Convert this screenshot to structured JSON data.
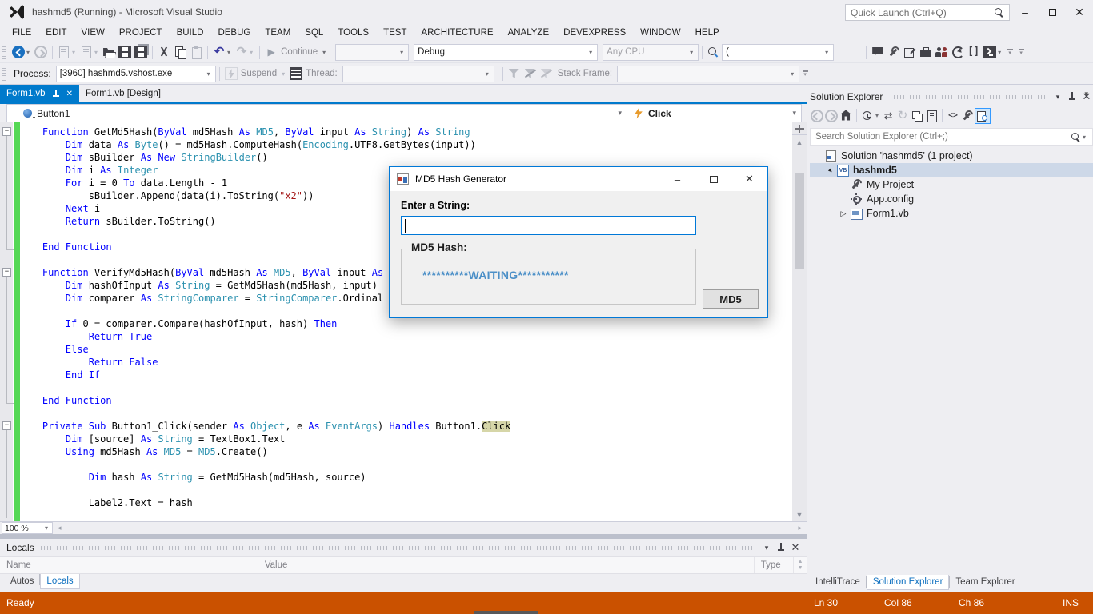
{
  "titlebar": {
    "title": "hashmd5 (Running) - Microsoft Visual Studio",
    "quick_launch_placeholder": "Quick Launch (Ctrl+Q)"
  },
  "menubar": [
    "FILE",
    "EDIT",
    "VIEW",
    "PROJECT",
    "BUILD",
    "DEBUG",
    "TEAM",
    "SQL",
    "TOOLS",
    "TEST",
    "ARCHITECTURE",
    "ANALYZE",
    "DEVEXPRESS",
    "WINDOW",
    "HELP"
  ],
  "toolbar": {
    "continue_label": "Continue",
    "solution_config_value": "Debug",
    "platform_value": "Any CPU",
    "find_value": "("
  },
  "debug_location_toolbar": {
    "process_label": "Process:",
    "process_value": "[3960] hashmd5.vshost.exe",
    "suspend_label": "Suspend",
    "thread_label": "Thread:",
    "thread_value": "",
    "stack_frame_label": "Stack Frame:",
    "stack_frame_value": ""
  },
  "document_tabs": [
    {
      "label": "Form1.vb",
      "active": true
    },
    {
      "label": "Form1.vb [Design]",
      "active": false
    }
  ],
  "navigation_bar": {
    "scope": "Button1",
    "member": "Click"
  },
  "editor": {
    "zoom_value": "100 %",
    "fold_regions": [
      {
        "start": 0,
        "end": 9
      },
      {
        "start": 11,
        "end": 21
      },
      {
        "start": 23,
        "end": -1
      }
    ],
    "lines": [
      {
        "f": "s",
        "t": [
          [
            "k",
            "    Function"
          ],
          [
            "p",
            " GetMd5Hash("
          ],
          [
            "k",
            "ByVal"
          ],
          [
            "p",
            " md5Hash "
          ],
          [
            "k",
            "As"
          ],
          [
            "p",
            " "
          ],
          [
            "t",
            "MD5"
          ],
          [
            "p",
            ", "
          ],
          [
            "k",
            "ByVal"
          ],
          [
            "p",
            " input "
          ],
          [
            "k",
            "As"
          ],
          [
            "p",
            " "
          ],
          [
            "t",
            "String"
          ],
          [
            "p",
            ") "
          ],
          [
            "k",
            "As"
          ],
          [
            "p",
            " "
          ],
          [
            "t",
            "String"
          ]
        ]
      },
      {
        "f": "m",
        "t": [
          [
            "p",
            "        "
          ],
          [
            "k",
            "Dim"
          ],
          [
            "p",
            " data "
          ],
          [
            "k",
            "As"
          ],
          [
            "p",
            " "
          ],
          [
            "t",
            "Byte"
          ],
          [
            "p",
            "() = md5Hash.ComputeHash("
          ],
          [
            "t",
            "Encoding"
          ],
          [
            "p",
            ".UTF8.GetBytes(input))"
          ]
        ]
      },
      {
        "f": "m",
        "t": [
          [
            "p",
            "        "
          ],
          [
            "k",
            "Dim"
          ],
          [
            "p",
            " sBuilder "
          ],
          [
            "k",
            "As"
          ],
          [
            "p",
            " "
          ],
          [
            "k",
            "New"
          ],
          [
            "p",
            " "
          ],
          [
            "t",
            "StringBuilder"
          ],
          [
            "p",
            "()"
          ]
        ]
      },
      {
        "f": "m",
        "t": [
          [
            "p",
            "        "
          ],
          [
            "k",
            "Dim"
          ],
          [
            "p",
            " i "
          ],
          [
            "k",
            "As"
          ],
          [
            "p",
            " "
          ],
          [
            "t",
            "Integer"
          ]
        ]
      },
      {
        "f": "m",
        "t": [
          [
            "p",
            "        "
          ],
          [
            "k",
            "For"
          ],
          [
            "p",
            " i = 0 "
          ],
          [
            "k",
            "To"
          ],
          [
            "p",
            " data.Length - 1"
          ]
        ]
      },
      {
        "f": "m",
        "t": [
          [
            "p",
            "            sBuilder.Append(data(i).ToString("
          ],
          [
            "s",
            "\"x2\""
          ],
          [
            "p",
            "))"
          ]
        ]
      },
      {
        "f": "m",
        "t": [
          [
            "p",
            "        "
          ],
          [
            "k",
            "Next"
          ],
          [
            "p",
            " i"
          ]
        ]
      },
      {
        "f": "m",
        "t": [
          [
            "p",
            "        "
          ],
          [
            "k",
            "Return"
          ],
          [
            "p",
            " sBuilder.ToString()"
          ]
        ]
      },
      {
        "f": "m",
        "t": []
      },
      {
        "f": "e",
        "t": [
          [
            "k",
            "    End Function"
          ]
        ]
      },
      {
        "f": "n",
        "t": []
      },
      {
        "f": "s",
        "t": [
          [
            "k",
            "    Function"
          ],
          [
            "p",
            " VerifyMd5Hash("
          ],
          [
            "k",
            "ByVal"
          ],
          [
            "p",
            " md5Hash "
          ],
          [
            "k",
            "As"
          ],
          [
            "p",
            " "
          ],
          [
            "t",
            "MD5"
          ],
          [
            "p",
            ", "
          ],
          [
            "k",
            "ByVal"
          ],
          [
            "p",
            " input "
          ],
          [
            "k",
            "As"
          ]
        ]
      },
      {
        "f": "m",
        "t": [
          [
            "p",
            "        "
          ],
          [
            "k",
            "Dim"
          ],
          [
            "p",
            " hashOfInput "
          ],
          [
            "k",
            "As"
          ],
          [
            "p",
            " "
          ],
          [
            "t",
            "String"
          ],
          [
            "p",
            " = GetMd5Hash(md5Hash, input)"
          ]
        ]
      },
      {
        "f": "m",
        "t": [
          [
            "p",
            "        "
          ],
          [
            "k",
            "Dim"
          ],
          [
            "p",
            " comparer "
          ],
          [
            "k",
            "As"
          ],
          [
            "p",
            " "
          ],
          [
            "t",
            "StringComparer"
          ],
          [
            "p",
            " = "
          ],
          [
            "t",
            "StringComparer"
          ],
          [
            "p",
            ".Ordinal"
          ]
        ]
      },
      {
        "f": "m",
        "t": []
      },
      {
        "f": "m",
        "t": [
          [
            "p",
            "        "
          ],
          [
            "k",
            "If"
          ],
          [
            "p",
            " 0 = comparer.Compare(hashOfInput, hash) "
          ],
          [
            "k",
            "Then"
          ]
        ]
      },
      {
        "f": "m",
        "t": [
          [
            "p",
            "            "
          ],
          [
            "k",
            "Return"
          ],
          [
            "p",
            " "
          ],
          [
            "k",
            "True"
          ]
        ]
      },
      {
        "f": "m",
        "t": [
          [
            "p",
            "        "
          ],
          [
            "k",
            "Else"
          ]
        ]
      },
      {
        "f": "m",
        "t": [
          [
            "p",
            "            "
          ],
          [
            "k",
            "Return"
          ],
          [
            "p",
            " "
          ],
          [
            "k",
            "False"
          ]
        ]
      },
      {
        "f": "m",
        "t": [
          [
            "p",
            "        "
          ],
          [
            "k",
            "End If"
          ]
        ]
      },
      {
        "f": "m",
        "t": []
      },
      {
        "f": "e",
        "t": [
          [
            "k",
            "    End Function"
          ]
        ]
      },
      {
        "f": "n",
        "t": []
      },
      {
        "f": "s",
        "t": [
          [
            "k",
            "    Private"
          ],
          [
            "p",
            " "
          ],
          [
            "k",
            "Sub"
          ],
          [
            "p",
            " Button1_Click(sender "
          ],
          [
            "k",
            "As"
          ],
          [
            "p",
            " "
          ],
          [
            "t",
            "Object"
          ],
          [
            "p",
            ", e "
          ],
          [
            "k",
            "As"
          ],
          [
            "p",
            " "
          ],
          [
            "t",
            "EventArgs"
          ],
          [
            "p",
            ") "
          ],
          [
            "k",
            "Handles"
          ],
          [
            "p",
            " Button1."
          ],
          [
            "h",
            "Click"
          ]
        ]
      },
      {
        "f": "m",
        "t": [
          [
            "p",
            "        "
          ],
          [
            "k",
            "Dim"
          ],
          [
            "p",
            " [source] "
          ],
          [
            "k",
            "As"
          ],
          [
            "p",
            " "
          ],
          [
            "t",
            "String"
          ],
          [
            "p",
            " = TextBox1.Text"
          ]
        ]
      },
      {
        "f": "m",
        "t": [
          [
            "p",
            "        "
          ],
          [
            "k",
            "Using"
          ],
          [
            "p",
            " md5Hash "
          ],
          [
            "k",
            "As"
          ],
          [
            "p",
            " "
          ],
          [
            "t",
            "MD5"
          ],
          [
            "p",
            " = "
          ],
          [
            "t",
            "MD5"
          ],
          [
            "p",
            ".Create()"
          ]
        ]
      },
      {
        "f": "m",
        "t": []
      },
      {
        "f": "m",
        "t": [
          [
            "p",
            "            "
          ],
          [
            "k",
            "Dim"
          ],
          [
            "p",
            " hash "
          ],
          [
            "k",
            "As"
          ],
          [
            "p",
            " "
          ],
          [
            "t",
            "String"
          ],
          [
            "p",
            " = GetMd5Hash(md5Hash, source)"
          ]
        ]
      },
      {
        "f": "m",
        "t": []
      },
      {
        "f": "m",
        "t": [
          [
            "p",
            "            Label2.Text = hash"
          ]
        ]
      }
    ]
  },
  "dialog": {
    "title": "MD5 Hash Generator",
    "prompt_label": "Enter a String:",
    "input_value": "",
    "group_label": "MD5 Hash:",
    "hash_placeholder": "**********WAITING***********",
    "button_label": "MD5"
  },
  "solution_explorer": {
    "title": "Solution Explorer",
    "search_placeholder": "Search Solution Explorer (Ctrl+;)",
    "tree": [
      {
        "depth": 0,
        "icon": "solution",
        "label": "Solution 'hashmd5' (1 project)",
        "arrow": "none",
        "selected": false,
        "bold": false
      },
      {
        "depth": 1,
        "icon": "vb-project",
        "label": "hashmd5",
        "arrow": "expanded",
        "selected": true,
        "bold": true
      },
      {
        "depth": 2,
        "icon": "my-project",
        "label": "My Project",
        "arrow": "none",
        "selected": false,
        "bold": false
      },
      {
        "depth": 2,
        "icon": "app-config",
        "label": "App.config",
        "arrow": "none",
        "selected": false,
        "bold": false
      },
      {
        "depth": 2,
        "icon": "form",
        "label": "Form1.vb",
        "arrow": "collapsed",
        "selected": false,
        "bold": false
      }
    ]
  },
  "locals_panel": {
    "title": "Locals",
    "columns": [
      "Name",
      "Value",
      "Type"
    ],
    "tabs": [
      {
        "label": "Autos",
        "active": false
      },
      {
        "label": "Locals",
        "active": true
      }
    ]
  },
  "panel_tabs": [
    {
      "label": "IntelliTrace",
      "active": false
    },
    {
      "label": "Solution Explorer",
      "active": true
    },
    {
      "label": "Team Explorer",
      "active": false
    }
  ],
  "statusbar": {
    "status": "Ready",
    "line": "Ln 30",
    "column": "Col 86",
    "character": "Ch 86",
    "mode": "INS"
  },
  "colors": {
    "accent": "#007acc",
    "status_debug": "#ca5100",
    "keyword": "#0000ff",
    "type": "#2b91af",
    "string": "#a31515",
    "change_bar": "#55d855",
    "reference_highlight": "#d6d6a8",
    "waiting_text": "#4b8fc7"
  }
}
